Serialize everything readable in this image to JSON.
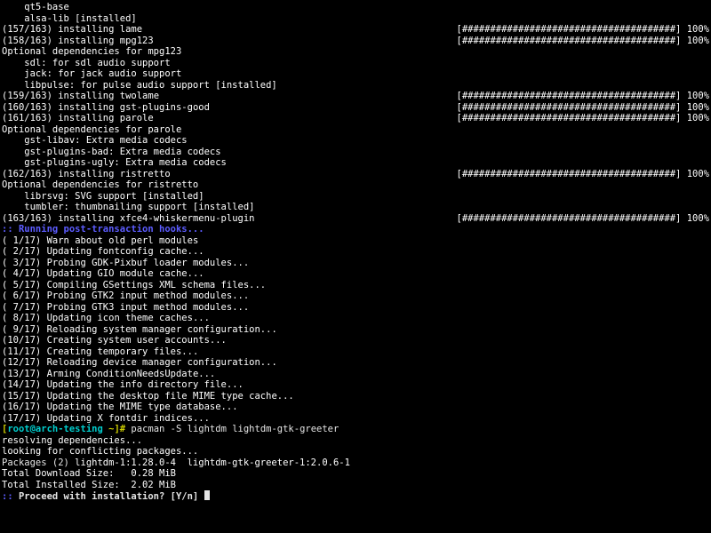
{
  "optdep_prefix": "    ",
  "pkg_lines": [
    {
      "text": "    qt5-base"
    },
    {
      "text": "    alsa-lib [installed]"
    }
  ],
  "install1": [
    {
      "counter": "(157/163)",
      "label": " installing lame"
    },
    {
      "counter": "(158/163)",
      "label": " installing mpg123"
    }
  ],
  "optdeps1": {
    "header": "Optional dependencies for mpg123",
    "items": [
      "sdl: for sdl audio support",
      "jack: for jack audio support",
      "libpulse: for pulse audio support [installed]"
    ]
  },
  "install2": [
    {
      "counter": "(159/163)",
      "label": " installing twolame"
    },
    {
      "counter": "(160/163)",
      "label": " installing gst-plugins-good"
    },
    {
      "counter": "(161/163)",
      "label": " installing parole"
    }
  ],
  "optdeps2": {
    "header": "Optional dependencies for parole",
    "items": [
      "gst-libav: Extra media codecs",
      "gst-plugins-bad: Extra media codecs",
      "gst-plugins-ugly: Extra media codecs"
    ]
  },
  "install3": [
    {
      "counter": "(162/163)",
      "label": " installing ristretto"
    }
  ],
  "optdeps3": {
    "header": "Optional dependencies for ristretto",
    "items": [
      "librsvg: SVG support [installed]",
      "tumbler: thumbnailing support [installed]"
    ]
  },
  "install4": [
    {
      "counter": "(163/163)",
      "label": " installing xfce4-whiskermenu-plugin"
    }
  ],
  "progress_bar": "[######################################]",
  "progress_pct": " 100%",
  "hooks_header": ":: Running post-transaction hooks...",
  "hooks": [
    {
      "n": "( 1/17)",
      "t": " Warn about old perl modules"
    },
    {
      "n": "( 2/17)",
      "t": " Updating fontconfig cache..."
    },
    {
      "n": "( 3/17)",
      "t": " Probing GDK-Pixbuf loader modules..."
    },
    {
      "n": "( 4/17)",
      "t": " Updating GIO module cache..."
    },
    {
      "n": "( 5/17)",
      "t": " Compiling GSettings XML schema files..."
    },
    {
      "n": "( 6/17)",
      "t": " Probing GTK2 input method modules..."
    },
    {
      "n": "( 7/17)",
      "t": " Probing GTK3 input method modules..."
    },
    {
      "n": "( 8/17)",
      "t": " Updating icon theme caches..."
    },
    {
      "n": "( 9/17)",
      "t": " Reloading system manager configuration..."
    },
    {
      "n": "(10/17)",
      "t": " Creating system user accounts..."
    },
    {
      "n": "(11/17)",
      "t": " Creating temporary files..."
    },
    {
      "n": "(12/17)",
      "t": " Reloading device manager configuration..."
    },
    {
      "n": "(13/17)",
      "t": " Arming ConditionNeedsUpdate..."
    },
    {
      "n": "(14/17)",
      "t": " Updating the info directory file..."
    },
    {
      "n": "(15/17)",
      "t": " Updating the desktop file MIME type cache..."
    },
    {
      "n": "(16/17)",
      "t": " Updating the MIME type database..."
    },
    {
      "n": "(17/17)",
      "t": " Updating X fontdir indices..."
    }
  ],
  "prompt": {
    "open": "[",
    "user_host": "root@arch-testing",
    "sep": " ",
    "cwd": "~",
    "close": "]# ",
    "cmd": "pacman -S lightdm lightdm-gtk-greeter"
  },
  "resolve1": "resolving dependencies...",
  "resolve2": "looking for conflicting packages...",
  "pkgs_label": "Packages (2)",
  "pkgs_list": " lightdm-1:1.28.0-4  lightdm-gtk-greeter-1:2.0.6-1",
  "dl_size": "Total Download Size:   0.28 MiB",
  "in_size": "Total Installed Size:  2.02 MiB",
  "proceed_prefix": ":: ",
  "proceed_q": "Proceed with installation? [Y/n] "
}
